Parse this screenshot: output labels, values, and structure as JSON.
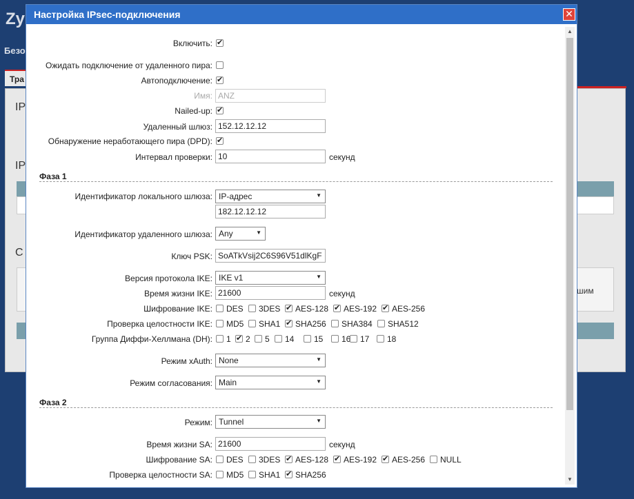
{
  "background": {
    "brand": "Zy",
    "sub": "Безо",
    "tab": "Тра",
    "h1": "IP",
    "h2": "IP",
    "h3": "С",
    "box_text": "шим"
  },
  "dialog": {
    "title": "Настройка IPsec-подключения",
    "close": "✕",
    "enable_label": "Включить:",
    "wait_label": "Ожидать подключение от удаленного пира:",
    "autoconnect_label": "Автоподключение:",
    "name_label": "Имя:",
    "name_value": "ANZ",
    "nailed_label": "Nailed-up:",
    "remote_gw_label": "Удаленный шлюз:",
    "remote_gw_value": "152.12.12.12",
    "dpd_label": "Обнаружение неработающего пира (DPD):",
    "interval_label": "Интервал проверки:",
    "interval_value": "10",
    "seconds": "секунд",
    "phase1": {
      "title": "Фаза 1",
      "local_id_label": "Идентификатор локального шлюза:",
      "local_id_type": "IP-адрес",
      "local_id_value": "182.12.12.12",
      "remote_id_label": "Идентификатор удаленного шлюза:",
      "remote_id_type": "Any",
      "psk_label": "Ключ PSK:",
      "psk_value": "SoATkVsij2C6S96V51dlKgF",
      "ike_version_label": "Версия протокола IKE:",
      "ike_version_value": "IKE v1",
      "ike_lifetime_label": "Время жизни IKE:",
      "ike_lifetime_value": "21600",
      "ike_enc_label": "Шифрование IKE:",
      "ike_enc": [
        {
          "label": "DES",
          "checked": false
        },
        {
          "label": "3DES",
          "checked": false
        },
        {
          "label": "AES-128",
          "checked": true
        },
        {
          "label": "AES-192",
          "checked": true
        },
        {
          "label": "AES-256",
          "checked": true
        }
      ],
      "ike_int_label": "Проверка целостности IKE:",
      "ike_int": [
        {
          "label": "MD5",
          "checked": false
        },
        {
          "label": "SHA1",
          "checked": false
        },
        {
          "label": "SHA256",
          "checked": true
        },
        {
          "label": "SHA384",
          "checked": false
        },
        {
          "label": "SHA512",
          "checked": false
        }
      ],
      "dh_label": "Группа Диффи-Хеллмана (DH):",
      "dh": [
        {
          "label": "1",
          "checked": false
        },
        {
          "label": "2",
          "checked": true
        },
        {
          "label": "5",
          "checked": false
        },
        {
          "label": "14",
          "checked": false
        },
        {
          "label": "15",
          "checked": false
        },
        {
          "label": "16",
          "checked": false
        },
        {
          "label": "17",
          "checked": false
        },
        {
          "label": "18",
          "checked": false
        }
      ],
      "xauth_label": "Режим xAuth:",
      "xauth_value": "None",
      "negotiation_label": "Режим согласования:",
      "negotiation_value": "Main"
    },
    "phase2": {
      "title": "Фаза 2",
      "mode_label": "Режим:",
      "mode_value": "Tunnel",
      "sa_lifetime_label": "Время жизни SA:",
      "sa_lifetime_value": "21600",
      "sa_enc_label": "Шифрование SA:",
      "sa_enc": [
        {
          "label": "DES",
          "checked": false
        },
        {
          "label": "3DES",
          "checked": false
        },
        {
          "label": "AES-128",
          "checked": true
        },
        {
          "label": "AES-192",
          "checked": true
        },
        {
          "label": "AES-256",
          "checked": true
        },
        {
          "label": "NULL",
          "checked": false
        }
      ],
      "sa_int_label": "Проверка целостности SA:",
      "sa_int": [
        {
          "label": "MD5",
          "checked": false
        },
        {
          "label": "SHA1",
          "checked": false
        },
        {
          "label": "SHA256",
          "checked": true
        }
      ]
    }
  }
}
